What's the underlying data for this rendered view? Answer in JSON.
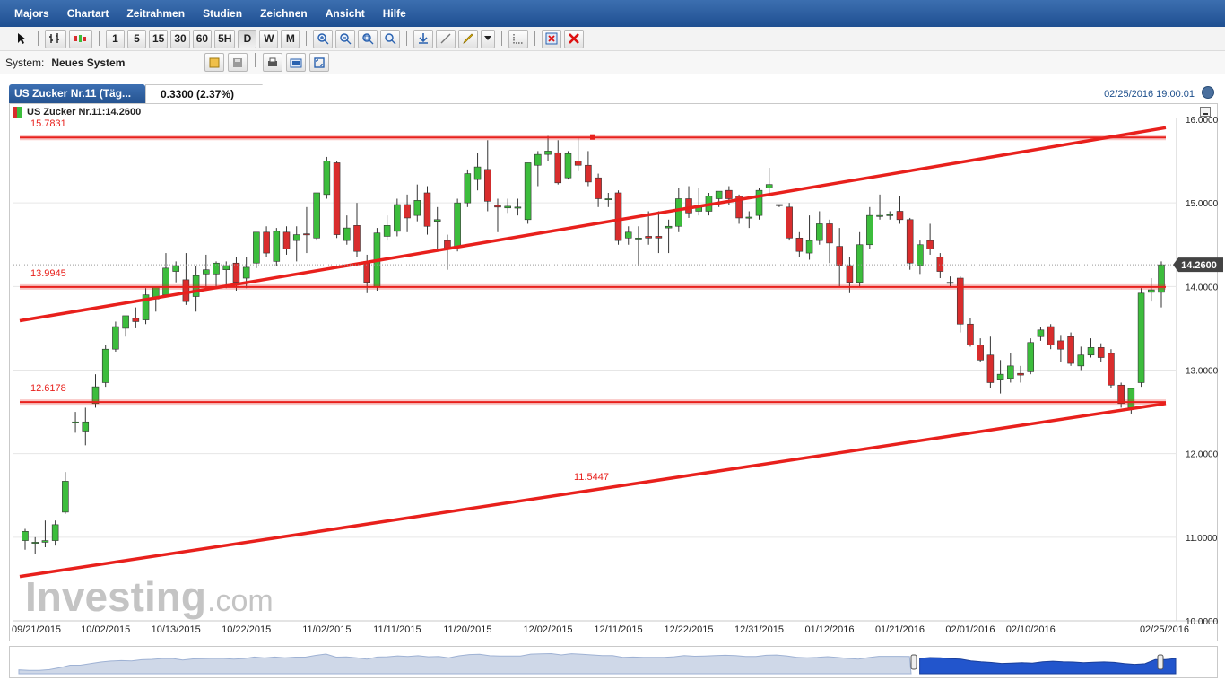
{
  "menu": [
    "Majors",
    "Chartart",
    "Zeitrahmen",
    "Studien",
    "Zeichnen",
    "Ansicht",
    "Hilfe"
  ],
  "toolbar": {
    "timeframes": [
      "1",
      "5",
      "15",
      "30",
      "60",
      "5H",
      "D",
      "W",
      "M"
    ],
    "active": "D"
  },
  "system": {
    "label": "System:",
    "value": "Neues System"
  },
  "tab": {
    "title": "US Zucker Nr.11 (Täg...",
    "change": "0.3300 (2.37%)"
  },
  "timestamp": "02/25/2016 19:00:01",
  "chart_title": "US Zucker Nr.11:14.2600",
  "watermark": {
    "main": "Investing",
    "suffix": ".com"
  },
  "colors": {
    "up": "#3cbd3c",
    "down": "#d92d2d",
    "line": "#e8201c",
    "accent": "#1f4f91"
  },
  "chart_data": {
    "type": "candlestick",
    "ylim": [
      10,
      16
    ],
    "yticks": [
      "16.0000",
      "15.0000",
      "14.0000",
      "13.0000",
      "12.0000",
      "11.0000",
      "10.0000"
    ],
    "xticks": [
      "09/21/2015",
      "10/02/2015",
      "10/13/2015",
      "10/22/2015",
      "11/02/2015",
      "11/11/2015",
      "11/20/2015",
      "12/02/2015",
      "12/11/2015",
      "12/22/2015",
      "12/31/2015",
      "01/12/2016",
      "01/21/2016",
      "02/01/2016",
      "02/10/2016",
      "02/25/2016"
    ],
    "last_price": "14.2600",
    "candles": [
      [
        10.96,
        11.1,
        10.85,
        11.07
      ],
      [
        10.93,
        11.0,
        10.8,
        10.94
      ],
      [
        10.94,
        11.2,
        10.88,
        10.96
      ],
      [
        10.96,
        11.2,
        10.9,
        11.15
      ],
      [
        11.3,
        11.78,
        11.28,
        11.67
      ],
      [
        12.38,
        12.5,
        12.25,
        12.38
      ],
      [
        12.27,
        12.55,
        12.1,
        12.38
      ],
      [
        12.6,
        12.95,
        12.55,
        12.8
      ],
      [
        12.85,
        13.3,
        12.8,
        13.25
      ],
      [
        13.25,
        13.58,
        13.22,
        13.52
      ],
      [
        13.5,
        13.62,
        13.4,
        13.65
      ],
      [
        13.62,
        13.75,
        13.5,
        13.58
      ],
      [
        13.6,
        13.98,
        13.55,
        13.9
      ],
      [
        13.85,
        14.0,
        13.7,
        14.0
      ],
      [
        13.9,
        14.4,
        13.88,
        14.22
      ],
      [
        14.18,
        14.3,
        14.05,
        14.25
      ],
      [
        14.08,
        14.4,
        13.78,
        13.82
      ],
      [
        13.88,
        14.25,
        13.7,
        14.13
      ],
      [
        14.15,
        14.38,
        13.95,
        14.2
      ],
      [
        14.15,
        14.3,
        14.0,
        14.28
      ],
      [
        14.2,
        14.3,
        13.98,
        14.25
      ],
      [
        14.28,
        14.35,
        13.95,
        14.05
      ],
      [
        14.1,
        14.35,
        13.98,
        14.23
      ],
      [
        14.28,
        14.65,
        14.22,
        14.65
      ],
      [
        14.65,
        14.72,
        14.35,
        14.4
      ],
      [
        14.3,
        14.7,
        14.25,
        14.66
      ],
      [
        14.65,
        14.72,
        14.38,
        14.45
      ],
      [
        14.55,
        14.72,
        14.3,
        14.62
      ],
      [
        14.63,
        14.95,
        14.4,
        14.62
      ],
      [
        14.58,
        15.1,
        14.55,
        15.12
      ],
      [
        15.1,
        15.55,
        15.05,
        15.5
      ],
      [
        15.48,
        15.5,
        14.58,
        14.62
      ],
      [
        14.55,
        14.85,
        14.5,
        14.7
      ],
      [
        14.73,
        15.0,
        14.35,
        14.42
      ],
      [
        14.3,
        14.38,
        13.92,
        14.05
      ],
      [
        14.0,
        14.7,
        13.95,
        14.64
      ],
      [
        14.6,
        14.85,
        14.55,
        14.73
      ],
      [
        14.66,
        15.05,
        14.6,
        14.98
      ],
      [
        14.98,
        15.1,
        14.65,
        14.82
      ],
      [
        14.85,
        15.22,
        14.78,
        15.03
      ],
      [
        15.12,
        15.2,
        14.62,
        14.72
      ],
      [
        14.78,
        14.95,
        14.45,
        14.8
      ],
      [
        14.55,
        14.62,
        14.2,
        14.45
      ],
      [
        14.48,
        15.05,
        14.42,
        15.0
      ],
      [
        15.0,
        15.4,
        14.95,
        15.35
      ],
      [
        15.28,
        15.6,
        15.15,
        15.43
      ],
      [
        15.4,
        15.75,
        14.9,
        15.02
      ],
      [
        14.97,
        15.05,
        14.65,
        14.95
      ],
      [
        14.94,
        15.05,
        14.88,
        14.96
      ],
      [
        14.94,
        15.05,
        14.85,
        14.95
      ],
      [
        14.8,
        15.48,
        14.75,
        15.48
      ],
      [
        15.45,
        15.62,
        15.2,
        15.58
      ],
      [
        15.58,
        15.8,
        15.5,
        15.62
      ],
      [
        15.6,
        15.75,
        15.22,
        15.24
      ],
      [
        15.3,
        15.62,
        15.28,
        15.59
      ],
      [
        15.5,
        15.78,
        15.38,
        15.45
      ],
      [
        15.45,
        15.62,
        15.2,
        15.25
      ],
      [
        15.3,
        15.35,
        14.95,
        15.05
      ],
      [
        15.05,
        15.12,
        14.95,
        15.05
      ],
      [
        15.12,
        15.15,
        14.5,
        14.55
      ],
      [
        14.58,
        14.72,
        14.5,
        14.65
      ],
      [
        14.58,
        14.72,
        14.25,
        14.58
      ],
      [
        14.6,
        14.9,
        14.5,
        14.58
      ],
      [
        14.6,
        14.9,
        14.4,
        14.58
      ],
      [
        14.7,
        14.8,
        14.4,
        14.72
      ],
      [
        14.72,
        15.18,
        14.65,
        15.05
      ],
      [
        15.05,
        15.2,
        14.82,
        14.88
      ],
      [
        14.9,
        15.18,
        14.85,
        14.95
      ],
      [
        14.9,
        15.12,
        14.85,
        15.08
      ],
      [
        15.05,
        15.12,
        14.95,
        15.14
      ],
      [
        15.15,
        15.2,
        14.98,
        15.05
      ],
      [
        15.08,
        15.1,
        14.75,
        14.82
      ],
      [
        14.82,
        14.9,
        14.7,
        14.83
      ],
      [
        14.85,
        15.18,
        14.8,
        15.15
      ],
      [
        15.18,
        15.42,
        15.1,
        15.22
      ],
      [
        14.98,
        14.98,
        14.95,
        14.97
      ],
      [
        14.95,
        15.0,
        14.55,
        14.58
      ],
      [
        14.58,
        14.65,
        14.35,
        14.42
      ],
      [
        14.4,
        14.85,
        14.32,
        14.55
      ],
      [
        14.55,
        14.9,
        14.5,
        14.75
      ],
      [
        14.75,
        14.8,
        14.28,
        14.52
      ],
      [
        14.48,
        14.7,
        14.0,
        14.25
      ],
      [
        14.25,
        14.35,
        13.92,
        14.05
      ],
      [
        14.05,
        14.65,
        14.0,
        14.5
      ],
      [
        14.5,
        14.95,
        14.45,
        14.85
      ],
      [
        14.84,
        15.1,
        14.8,
        14.85
      ],
      [
        14.85,
        14.9,
        14.8,
        14.86
      ],
      [
        14.9,
        15.08,
        14.75,
        14.8
      ],
      [
        14.8,
        14.82,
        14.2,
        14.28
      ],
      [
        14.25,
        14.55,
        14.15,
        14.5
      ],
      [
        14.55,
        14.75,
        14.38,
        14.45
      ],
      [
        14.35,
        14.4,
        14.1,
        14.18
      ],
      [
        14.05,
        14.12,
        14.0,
        14.05
      ],
      [
        14.1,
        14.12,
        13.45,
        13.55
      ],
      [
        13.55,
        13.62,
        13.28,
        13.3
      ],
      [
        13.3,
        13.38,
        13.1,
        13.12
      ],
      [
        13.18,
        13.4,
        12.78,
        12.85
      ],
      [
        12.88,
        13.12,
        12.72,
        12.95
      ],
      [
        12.9,
        13.2,
        12.85,
        13.05
      ],
      [
        12.96,
        13.05,
        12.85,
        12.94
      ],
      [
        12.98,
        13.38,
        12.95,
        13.33
      ],
      [
        13.4,
        13.52,
        13.35,
        13.48
      ],
      [
        13.52,
        13.55,
        13.25,
        13.3
      ],
      [
        13.35,
        13.42,
        13.1,
        13.25
      ],
      [
        13.4,
        13.45,
        13.05,
        13.08
      ],
      [
        13.05,
        13.28,
        13.0,
        13.18
      ],
      [
        13.18,
        13.38,
        13.15,
        13.27
      ],
      [
        13.27,
        13.32,
        13.1,
        13.15
      ],
      [
        13.2,
        13.25,
        12.78,
        12.82
      ],
      [
        12.82,
        12.85,
        12.55,
        12.6
      ],
      [
        12.55,
        12.78,
        12.48,
        12.78
      ],
      [
        12.85,
        13.98,
        12.8,
        13.92
      ],
      [
        13.93,
        14.1,
        13.82,
        13.96
      ],
      [
        13.93,
        14.3,
        13.75,
        14.26
      ]
    ],
    "lines": [
      {
        "label": "15.7831",
        "y1": 15.7831,
        "y2": 15.7831
      },
      {
        "label": "13.9945",
        "y1": 13.9945,
        "y2": 13.9945
      },
      {
        "label": "12.6178",
        "y1": 12.6178,
        "y2": 12.6178
      },
      {
        "label": "",
        "y1": 13.59,
        "y2": 15.9
      },
      {
        "label": "11.5447",
        "y1": 10.53,
        "y2": 12.6
      }
    ],
    "grid": true
  }
}
